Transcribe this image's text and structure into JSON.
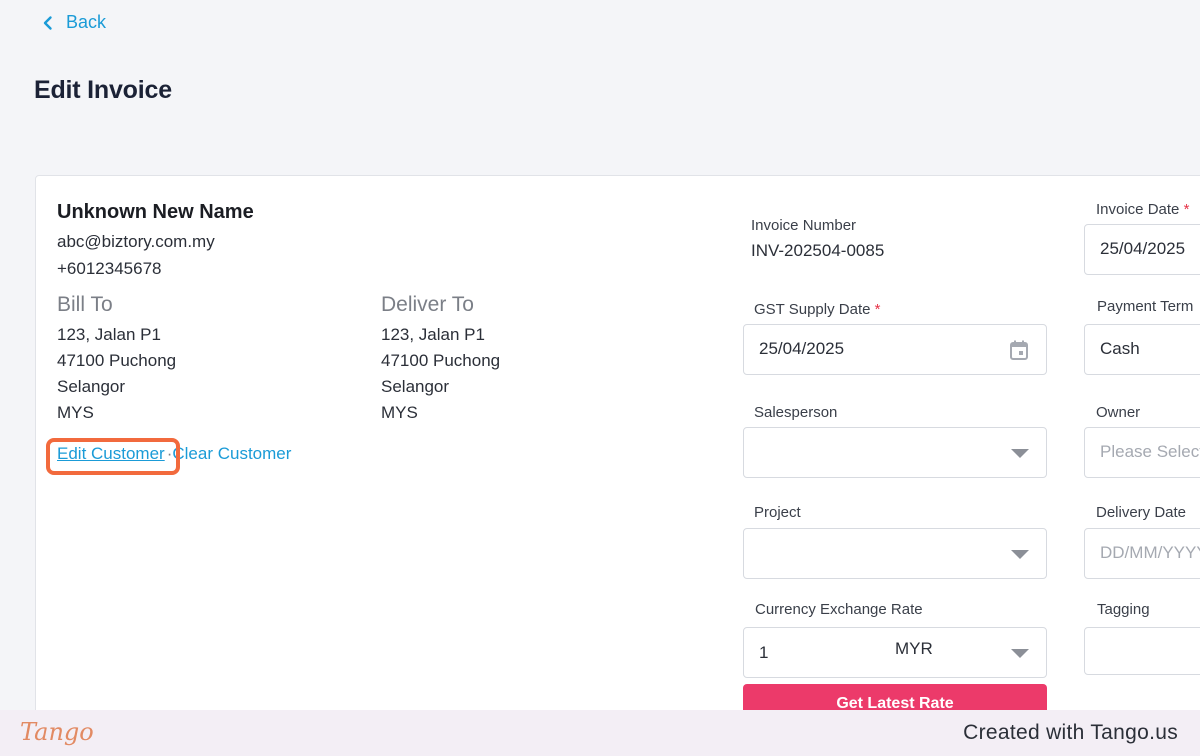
{
  "nav": {
    "back_label": "Back"
  },
  "page": {
    "title": "Edit Invoice"
  },
  "customer": {
    "name": "Unknown New Name",
    "email": "abc@biztory.com.my",
    "phone": "+6012345678",
    "bill_to": {
      "heading": "Bill To",
      "lines": [
        "123, Jalan P1",
        "47100 Puchong",
        "Selangor",
        "MYS"
      ]
    },
    "deliver_to": {
      "heading": "Deliver To",
      "lines": [
        "123, Jalan P1",
        "47100 Puchong",
        "Selangor",
        "MYS"
      ]
    },
    "edit_label": "Edit Customer",
    "separator": "·",
    "clear_label": "Clear Customer"
  },
  "form": {
    "invoice_number": {
      "label": "Invoice Number",
      "value": "INV-202504-0085"
    },
    "invoice_date": {
      "label": "Invoice Date",
      "required": "*",
      "value": "25/04/2025"
    },
    "gst_supply_date": {
      "label": "GST Supply Date",
      "required": "*",
      "value": "25/04/2025"
    },
    "payment_term": {
      "label": "Payment Term",
      "value": "Cash"
    },
    "salesperson": {
      "label": "Salesperson",
      "value": ""
    },
    "owner": {
      "label": "Owner",
      "placeholder": "Please Select"
    },
    "project": {
      "label": "Project",
      "value": ""
    },
    "delivery_date": {
      "label": "Delivery Date",
      "placeholder": "DD/MM/YYYY"
    },
    "currency_exchange_rate": {
      "label": "Currency Exchange Rate",
      "value": "1",
      "currency": "MYR"
    },
    "tagging": {
      "label": "Tagging",
      "value": ""
    },
    "get_latest_rate_label": "Get Latest Rate"
  },
  "footer": {
    "logo_text": "Tango",
    "created_text": "Created with Tango.us"
  },
  "colors": {
    "link": "#1a9bd7",
    "primary_button": "#ec3a6a",
    "highlight": "#f26a3d",
    "required": "#e63247"
  }
}
